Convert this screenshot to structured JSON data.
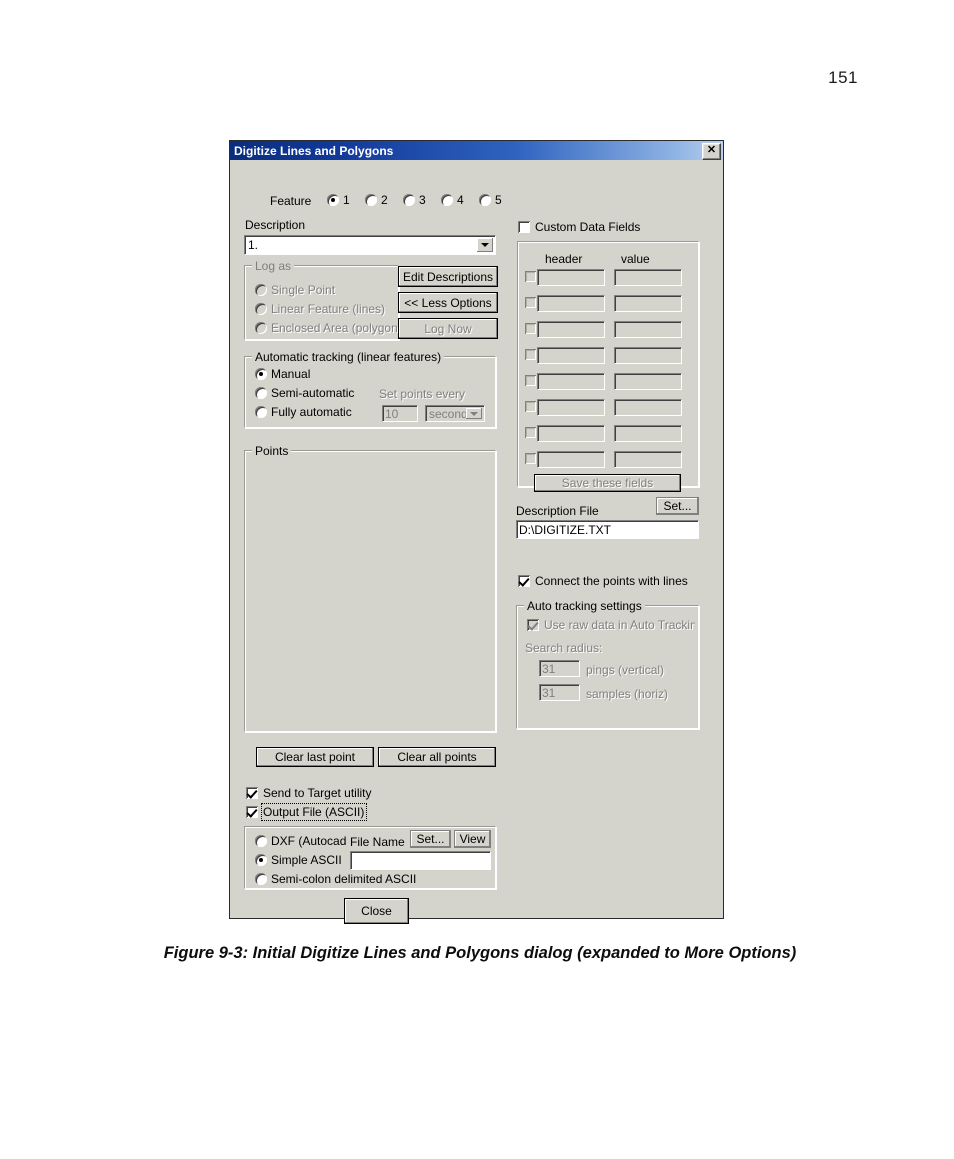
{
  "page": {
    "number": "151",
    "figure_caption": "Figure 9-3: Initial Digitize Lines and Polygons dialog (expanded to More Options)"
  },
  "dialog": {
    "title": "Digitize Lines and Polygons",
    "close_label": "✕",
    "feature": {
      "label": "Feature",
      "options": [
        "1",
        "2",
        "3",
        "4",
        "5"
      ],
      "selected": "1"
    },
    "description": {
      "label": "Description",
      "value": "1."
    },
    "log_as": {
      "title": "Log as",
      "options": [
        "Single Point",
        "Linear Feature (lines)",
        "Enclosed Area (polygon)"
      ],
      "selected": "",
      "enabled": false
    },
    "side_buttons": {
      "edit_descriptions": "Edit Descriptions",
      "less_options": "<< Less Options",
      "log_now": "Log Now"
    },
    "auto_tracking": {
      "title": "Automatic tracking (linear features)",
      "options": [
        "Manual",
        "Semi-automatic",
        "Fully automatic"
      ],
      "selected": "Manual",
      "set_points_label": "Set points every",
      "interval_value": "10",
      "interval_unit": "second:"
    },
    "points": {
      "title": "Points",
      "clear_last": "Clear last point",
      "clear_all": "Clear all points"
    },
    "send_to_target": {
      "label": "Send to Target utility",
      "checked": true
    },
    "output_file": {
      "label": "Output File (ASCII)",
      "checked": true,
      "focused": true,
      "formats": [
        "DXF (Autocad",
        "Simple ASCII",
        "Semi-colon delimited ASCII"
      ],
      "selected": "Simple ASCII",
      "file_name_label": "File Name",
      "file_name_value": "",
      "set_button": "Set...",
      "view_button": "View"
    },
    "close_button": "Close",
    "custom_data_fields": {
      "label": "Custom Data Fields",
      "checked": false,
      "header_col": "header",
      "value_col": "value",
      "rows": [
        {
          "enabled": false,
          "header": "",
          "value": ""
        },
        {
          "enabled": false,
          "header": "",
          "value": ""
        },
        {
          "enabled": false,
          "header": "",
          "value": ""
        },
        {
          "enabled": false,
          "header": "",
          "value": ""
        },
        {
          "enabled": false,
          "header": "",
          "value": ""
        },
        {
          "enabled": false,
          "header": "",
          "value": ""
        },
        {
          "enabled": false,
          "header": "",
          "value": ""
        },
        {
          "enabled": false,
          "header": "",
          "value": ""
        }
      ],
      "save_button": "Save these fields"
    },
    "description_file": {
      "label": "Description File",
      "set_button": "Set...",
      "value": "D:\\DIGITIZE.TXT"
    },
    "connect_points": {
      "label": "Connect the points with lines",
      "checked": true
    },
    "auto_tracking_settings": {
      "title": "Auto tracking settings",
      "use_raw_data": {
        "label": "Use raw data in Auto Trackinc",
        "checked": true,
        "enabled": false
      },
      "search_radius_label": "Search radius:",
      "vertical_value": "31",
      "vertical_unit": "pings (vertical)",
      "horizontal_value": "31",
      "horizontal_unit": "samples (horiz)"
    }
  },
  "colors": {
    "dialog_face": "#d4d4cc",
    "titlebar_start": "#0a2d7c",
    "titlebar_end": "#b8d0ef",
    "disabled_text": "#808080"
  }
}
